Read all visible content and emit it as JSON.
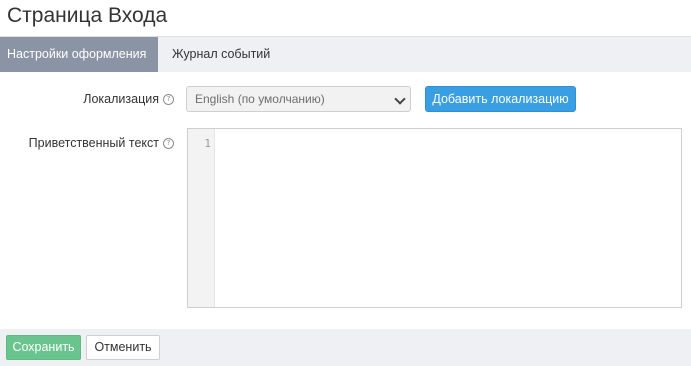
{
  "page": {
    "title": "Страница Входа"
  },
  "tabs": [
    {
      "label": "Настройки оформления",
      "active": true
    },
    {
      "label": "Журнал событий",
      "active": false
    }
  ],
  "form": {
    "localization": {
      "label": "Локализация",
      "help_icon": "question-circle-icon",
      "selected": "English (по умолчанию)",
      "add_button": "Добавить локализацию"
    },
    "welcome_text": {
      "label": "Приветственный текст",
      "help_icon": "question-circle-icon",
      "line_numbers": [
        "1"
      ],
      "value": ""
    }
  },
  "footer": {
    "save_label": "Сохранить",
    "cancel_label": "Отменить"
  },
  "colors": {
    "active_tab": "#8a94a5",
    "primary_button": "#3a9ee3",
    "save_button": "#69c48d",
    "tab_bar": "#eef0f3"
  }
}
